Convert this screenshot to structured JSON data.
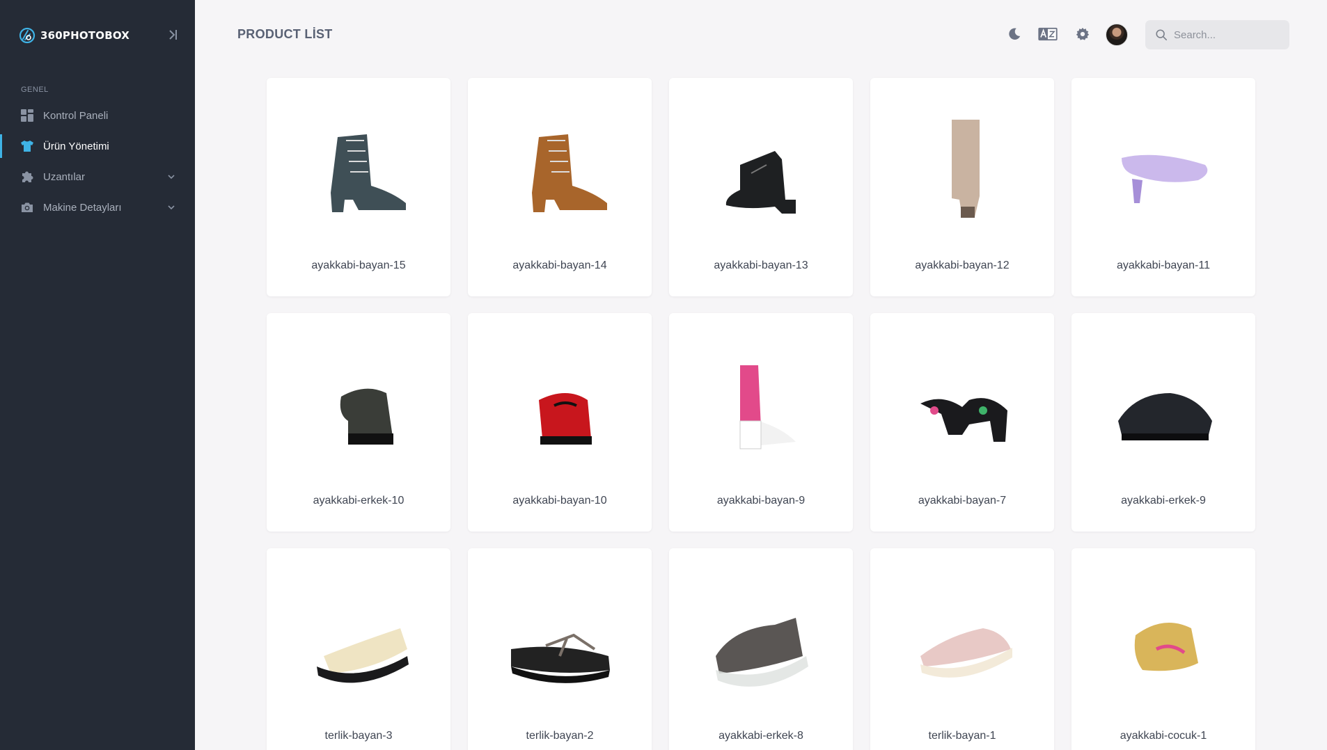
{
  "brand": {
    "name": "360PHOTOBOX"
  },
  "sidebar": {
    "section_label": "GENEL",
    "items": [
      {
        "label": "Kontrol Paneli",
        "icon": "dashboard-icon"
      },
      {
        "label": "Ürün Yönetimi",
        "icon": "shirt-icon",
        "active": true
      },
      {
        "label": "Uzantılar",
        "icon": "puzzle-icon",
        "expandable": true
      },
      {
        "label": "Makine Detayları",
        "icon": "camera-icon",
        "expandable": true
      }
    ]
  },
  "header": {
    "title": "PRODUCT LİST",
    "search_placeholder": "Search...",
    "icons": [
      "moon-icon",
      "translate-icon",
      "gear-icon"
    ]
  },
  "products": [
    {
      "name": "ayakkabi-bayan-15",
      "shape": "boot",
      "color": "#3f4f56"
    },
    {
      "name": "ayakkabi-bayan-14",
      "shape": "boot",
      "color": "#a8652b"
    },
    {
      "name": "ayakkabi-bayan-13",
      "shape": "ankle",
      "color": "#1e2022"
    },
    {
      "name": "ayakkabi-bayan-12",
      "shape": "tallboot",
      "color": "#c9b3a1"
    },
    {
      "name": "ayakkabi-bayan-11",
      "shape": "slingback",
      "color": "#cbb9ec"
    },
    {
      "name": "ayakkabi-erkek-10",
      "shape": "derby",
      "color": "#3a3d38"
    },
    {
      "name": "ayakkabi-bayan-10",
      "shape": "loafer",
      "color": "#c8161d"
    },
    {
      "name": "ayakkabi-bayan-9",
      "shape": "sandal",
      "color": "#e24a8a"
    },
    {
      "name": "ayakkabi-bayan-7",
      "shape": "strappy",
      "color": "#1a1a1d"
    },
    {
      "name": "ayakkabi-erkek-9",
      "shape": "oxford",
      "color": "#23262c"
    },
    {
      "name": "terlik-bayan-3",
      "shape": "slide",
      "color": "#efe4c3"
    },
    {
      "name": "terlik-bayan-2",
      "shape": "flip",
      "color": "#2a2a2c"
    },
    {
      "name": "ayakkabi-erkek-8",
      "shape": "sneaker",
      "color": "#5a5654"
    },
    {
      "name": "terlik-bayan-1",
      "shape": "slipper",
      "color": "#e8c9c6"
    },
    {
      "name": "ayakkabi-cocuk-1",
      "shape": "kids",
      "color": "#d9b55a"
    }
  ]
}
